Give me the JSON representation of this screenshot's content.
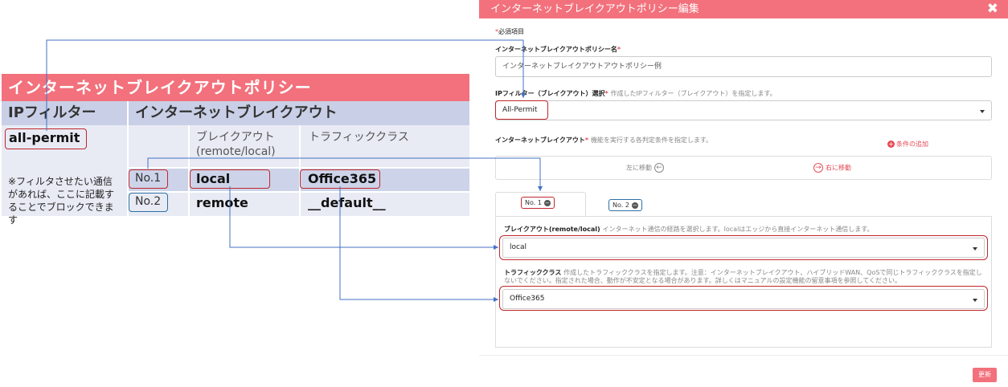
{
  "left_table": {
    "title": "インターネットブレイクアウトポリシー",
    "header_ip": "IPフィルター",
    "header_ib": "インターネットブレイクアウト",
    "ip_value": "all-permit",
    "note": "※フィルタさせたい通信があれば、ここに記載することでブロックできます",
    "col_breakout": "ブレイクアウト(remote/local)",
    "col_traffic": "トラフィッククラス",
    "rows": [
      {
        "num": "No.1",
        "breakout": "local",
        "traffic": "Office365"
      },
      {
        "num": "No.2",
        "breakout": "remote",
        "traffic": "__default__"
      }
    ]
  },
  "dialog": {
    "title": "インターネットブレイクアウトポリシー編集",
    "close": "✖",
    "required_note": "必須項目",
    "name_label": "インターネットブレイクアウトポリシー名",
    "name_value": "インターネットブレイクアウトアウトポリシー例",
    "ipfilter_label": "IPフィルター（ブレイクアウト）選択",
    "ipfilter_desc": "作成したIPフィルター（ブレイクアウト）を指定します。",
    "ipfilter_value": "All-Permit",
    "ib_label": "インターネットブレイクアウト",
    "ib_desc": "機能を実行する各判定条件を指定します。",
    "add_condition": "条件の追加",
    "move_left": "左に移動",
    "move_right": "右に移動",
    "tabs": [
      "No. 1",
      "No. 2"
    ],
    "breakout_label": "ブレイクアウト(remote/local)",
    "breakout_desc": "インターネット通信の経路を選択します。localはエッジから直接インターネット通信します。",
    "breakout_value": "local",
    "traffic_label": "トラフィッククラス",
    "traffic_desc": "作成したトラフィッククラスを指定します。注意：インターネットブレイクアウト、ハイブリッドWAN、QoSで同じトラフィッククラスを指定しないでください。指定された場合、動作が不安定となる場合があります。詳しくはマニュアルの設定機能の留意事項を参照してください。",
    "traffic_value": "Office365",
    "update_button": "更新"
  },
  "colors": {
    "accent": "#f2717c",
    "highlight_red": "#c0272d",
    "highlight_blue": "#2d6fa6",
    "arrow": "#4472c4"
  }
}
